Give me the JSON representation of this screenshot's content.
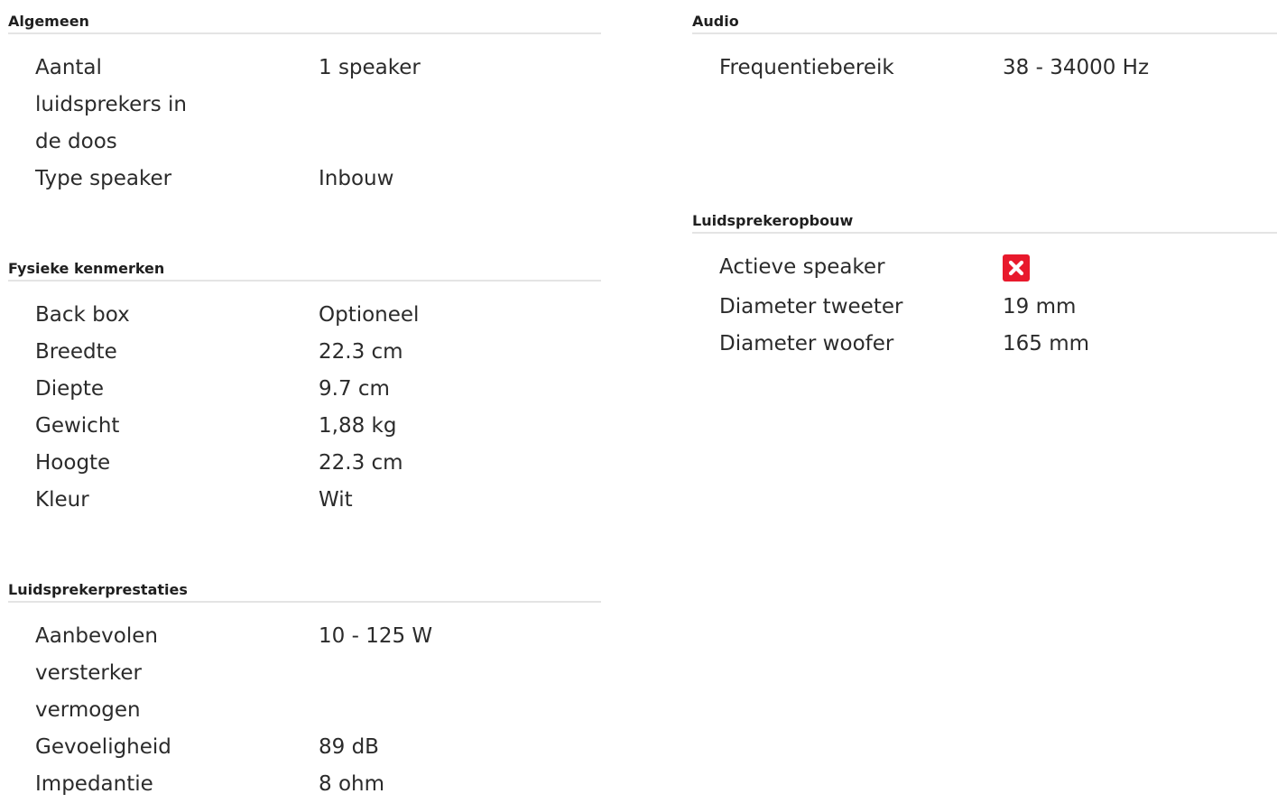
{
  "sections": {
    "algemeen": {
      "title": "Algemeen",
      "rows": [
        {
          "label": "Aantal luidsprekers in de doos",
          "value": "1 speaker"
        },
        {
          "label": "Type speaker",
          "value": "Inbouw"
        }
      ]
    },
    "fysieke": {
      "title": "Fysieke kenmerken",
      "rows": [
        {
          "label": "Back box",
          "value": "Optioneel"
        },
        {
          "label": "Breedte",
          "value": "22.3 cm"
        },
        {
          "label": "Diepte",
          "value": "9.7 cm"
        },
        {
          "label": "Gewicht",
          "value": "1,88 kg"
        },
        {
          "label": "Hoogte",
          "value": "22.3 cm"
        },
        {
          "label": "Kleur",
          "value": "Wit"
        }
      ]
    },
    "prestaties": {
      "title": "Luidsprekerprestaties",
      "rows": [
        {
          "label": "Aanbevolen versterker vermogen",
          "value": "10 - 125 W"
        },
        {
          "label": "Gevoeligheid",
          "value": "89 dB"
        },
        {
          "label": "Impedantie",
          "value": "8 ohm"
        }
      ]
    },
    "audio": {
      "title": "Audio",
      "rows": [
        {
          "label": "Frequentiebereik",
          "value": "38 - 34000 Hz"
        }
      ]
    },
    "opbouw": {
      "title": "Luidsprekeropbouw",
      "rows": [
        {
          "label": "Actieve speaker",
          "value_icon": "cross-icon",
          "value_bool": false
        },
        {
          "label": "Diameter tweeter",
          "value": "19 mm"
        },
        {
          "label": "Diameter woofer",
          "value": "165 mm"
        }
      ]
    }
  },
  "colors": {
    "negative_badge": "#e8192c",
    "divider": "#e4e4e4",
    "text": "#2b2b2b"
  }
}
